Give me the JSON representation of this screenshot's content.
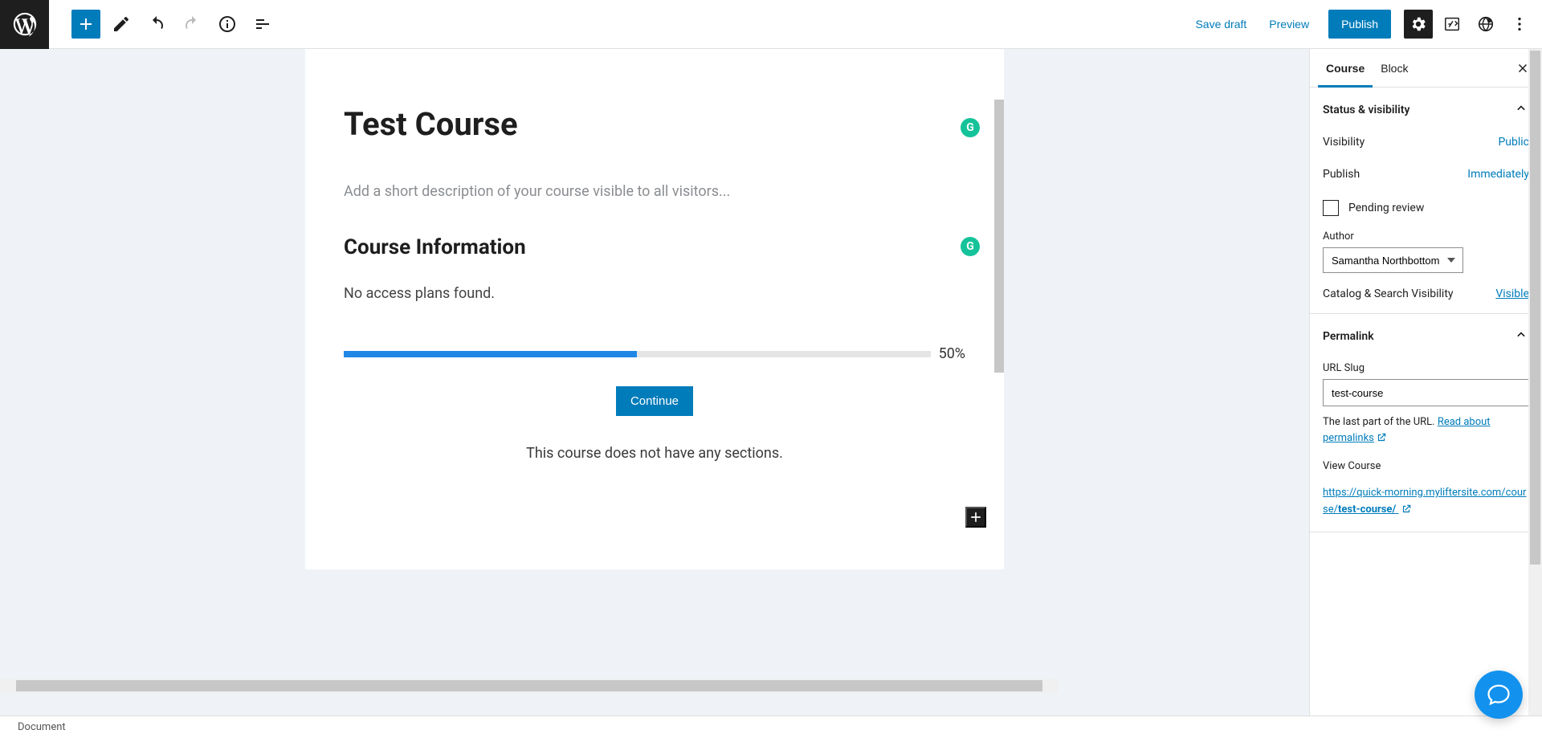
{
  "toolbar": {
    "save_draft": "Save draft",
    "preview": "Preview",
    "publish": "Publish"
  },
  "editor": {
    "title": "Test Course",
    "description_placeholder": "Add a short description of your course visible to all visitors...",
    "info_heading": "Course Information",
    "no_plans": "No access plans found.",
    "progress_percent": 50,
    "progress_label": "50%",
    "continue": "Continue",
    "no_sections": "This course does not have any sections."
  },
  "sidebar": {
    "tabs": {
      "course": "Course",
      "block": "Block"
    },
    "status": {
      "title": "Status & visibility",
      "visibility_label": "Visibility",
      "visibility_value": "Public",
      "publish_label": "Publish",
      "publish_value": "Immediately",
      "pending_review": "Pending review",
      "author_label": "Author",
      "author_value": "Samantha Northbottom",
      "catalog_label": "Catalog & Search Visibility",
      "catalog_value": "Visible"
    },
    "permalink": {
      "title": "Permalink",
      "slug_label": "URL Slug",
      "slug_value": "test-course",
      "helper_prefix": "The last part of the URL. ",
      "helper_link": "Read about permalinks",
      "view_course": "View Course",
      "url_prefix": "https://quick-morning.myliftersite.com/course/",
      "url_bold": "test-course/"
    }
  },
  "statusbar": {
    "breadcrumb": "Document"
  }
}
